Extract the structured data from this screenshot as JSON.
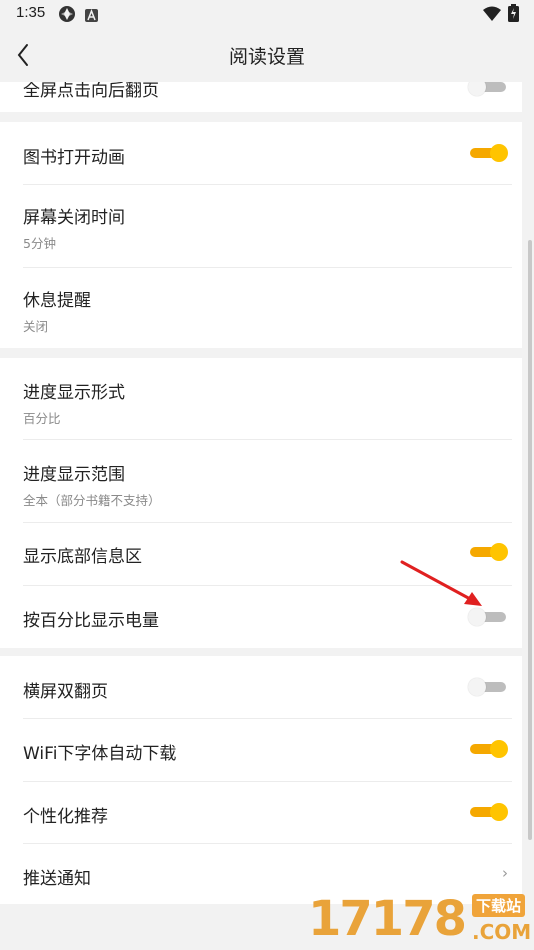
{
  "status_bar": {
    "time": "1:35",
    "icons": [
      "shutter-icon",
      "a-badge-icon",
      "wifi-icon",
      "battery-charging-icon"
    ]
  },
  "app_bar": {
    "title": "阅读设置",
    "back_icon": "chevron-left-icon"
  },
  "sections": [
    {
      "items": [
        {
          "label": "全屏点击向后翻页",
          "control": "toggle",
          "on": false
        }
      ]
    },
    {
      "items": [
        {
          "label": "图书打开动画",
          "control": "toggle",
          "on": true
        },
        {
          "label": "屏幕关闭时间",
          "sub": "5分钟",
          "control": "none"
        },
        {
          "label": "休息提醒",
          "sub": "关闭",
          "control": "none"
        }
      ]
    },
    {
      "items": [
        {
          "label": "进度显示形式",
          "sub": "百分比",
          "control": "none"
        },
        {
          "label": "进度显示范围",
          "sub": "全本（部分书籍不支持）",
          "control": "none"
        },
        {
          "label": "显示底部信息区",
          "control": "toggle",
          "on": true
        },
        {
          "label": "按百分比显示电量",
          "control": "toggle",
          "on": false
        }
      ]
    },
    {
      "items": [
        {
          "label": "横屏双翻页",
          "control": "toggle",
          "on": false
        },
        {
          "label": "WiFi下字体自动下载",
          "control": "toggle",
          "on": true
        },
        {
          "label": "个性化推荐",
          "control": "toggle",
          "on": true
        },
        {
          "label": "推送通知",
          "control": "chevron",
          "chevron": "›"
        }
      ]
    }
  ],
  "annotation": {
    "arrow_color": "#e02020"
  },
  "watermark": {
    "number": "17178",
    "badge": "下载站",
    "domain": ".COM"
  },
  "colors": {
    "toggle_on": "#ffc400",
    "toggle_off": "#bdbdbd",
    "background": "#f2f2f2"
  }
}
